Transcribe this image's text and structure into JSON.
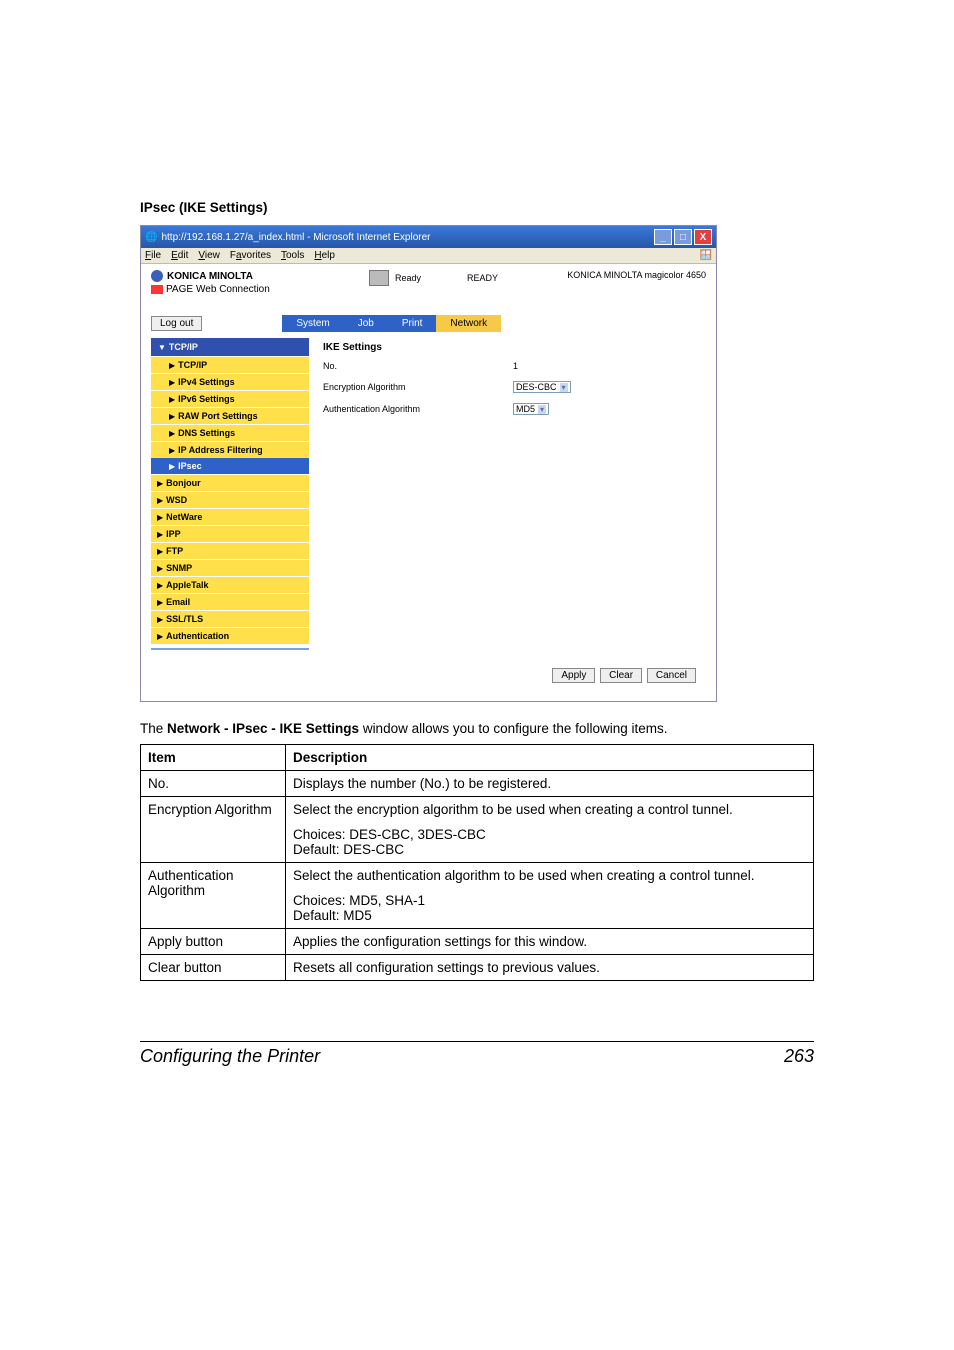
{
  "sectionTitle": "IPsec (IKE Settings)",
  "browser": {
    "title": "http://192.168.1.27/a_index.html - Microsoft Internet Explorer",
    "menus": [
      "File",
      "Edit",
      "View",
      "Favorites",
      "Tools",
      "Help"
    ]
  },
  "header": {
    "brand": "KONICA MINOLTA",
    "subbrand": "PageScope Web Connection",
    "statusLabel": "Ready",
    "statusText": "READY",
    "model": "KONICA MINOLTA magicolor 4650"
  },
  "logout": "Log out",
  "tabs": [
    "System",
    "Job",
    "Print",
    "Network"
  ],
  "sidebar": {
    "top": "TCP/IP",
    "items": [
      "TCP/IP",
      "IPv4 Settings",
      "IPv6 Settings",
      "RAW Port Settings",
      "DNS Settings",
      "IP Address Filtering",
      "IPsec"
    ],
    "others": [
      "Bonjour",
      "WSD",
      "NetWare",
      "IPP",
      "FTP",
      "SNMP",
      "AppleTalk",
      "Email",
      "SSL/TLS",
      "Authentication"
    ]
  },
  "panel": {
    "heading": "IKE Settings",
    "rows": [
      {
        "label": "No.",
        "value": "1"
      },
      {
        "label": "Encryption Algorithm",
        "value": "DES-CBC"
      },
      {
        "label": "Authentication Algorithm",
        "value": "MD5"
      }
    ],
    "buttons": [
      "Apply",
      "Clear",
      "Cancel"
    ]
  },
  "intro": "The <b>Network - IPsec - IKE Settings</b> window allows you to configure the following items.",
  "tableHead": [
    "Item",
    "Description"
  ],
  "tableRows": [
    {
      "item": "No.",
      "desc": "Displays the number (No.) to be registered."
    },
    {
      "item": "Encryption Algorithm",
      "desc": "Select the encryption algorithm to be used when creating a control tunnel.",
      "sub": "Choices: DES-CBC, 3DES-CBC\nDefault:  DES-CBC"
    },
    {
      "item": "Authentication Algorithm",
      "desc": "Select the authentication algorithm to be used when creating a control tunnel.",
      "sub": "Choices: MD5, SHA-1\nDefault:  MD5"
    },
    {
      "item": "Apply button",
      "desc": "Applies the configuration settings for this window."
    },
    {
      "item": "Clear button",
      "desc": "Resets all configuration settings to previous values."
    }
  ],
  "footer": {
    "left": "Configuring the Printer",
    "right": "263"
  }
}
